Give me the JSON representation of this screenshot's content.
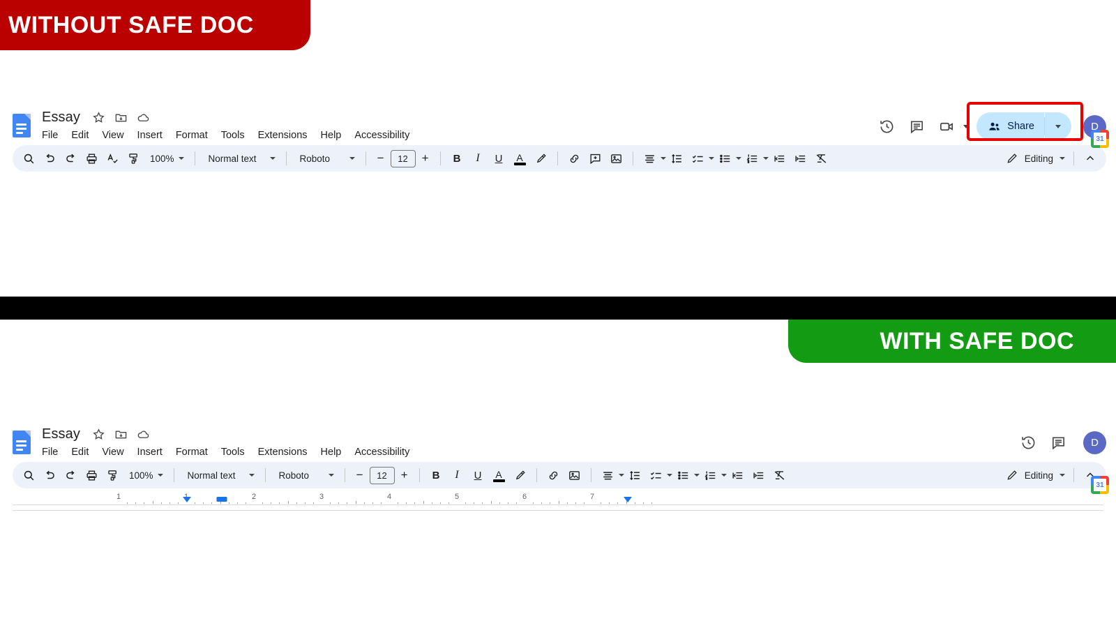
{
  "banners": {
    "without": {
      "label": "WITHOUT SAFE DOC",
      "color": "#bb0000"
    },
    "with": {
      "label": "WITH SAFE DOC",
      "color": "#129b13"
    }
  },
  "doc": {
    "title": "Essay",
    "title_icons": [
      "star-icon",
      "move-to-folder-icon",
      "cloud-saved-icon"
    ],
    "menu": [
      "File",
      "Edit",
      "View",
      "Insert",
      "Format",
      "Tools",
      "Extensions",
      "Help",
      "Accessibility"
    ],
    "avatar_initial": "D",
    "share_label": "Share"
  },
  "toolbar": {
    "zoom": "100%",
    "style": "Normal text",
    "font": "Roboto",
    "font_size": "12",
    "minus": "−",
    "plus": "+",
    "bold": "B",
    "italic": "I",
    "underline": "U",
    "text_color": "A",
    "mode": "Editing",
    "calendar_day": "31"
  },
  "ruler": {
    "numbers": [
      "1",
      "1",
      "2",
      "3",
      "4",
      "5",
      "6",
      "7"
    ],
    "left_indent_marker": "first-line-indent",
    "left_margin_marker": "left-indent",
    "right_indent_marker": "right-indent"
  },
  "top_panel": {
    "has_share_button": true,
    "has_meet_icon": true,
    "has_spellcheck_icon": true,
    "has_add_comment_icon": true,
    "share_highlight_color": "#e60000"
  },
  "bottom_panel": {
    "has_share_button": false,
    "has_meet_icon": false,
    "has_spellcheck_icon": false,
    "has_add_comment_icon": false
  }
}
